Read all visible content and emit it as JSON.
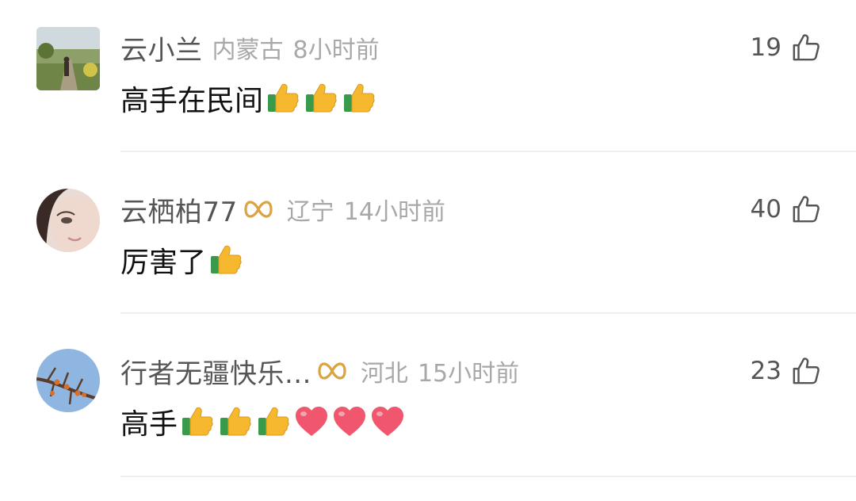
{
  "comments": [
    {
      "username": "云小兰",
      "vip": false,
      "location": "内蒙古",
      "time": "8小时前",
      "likes": "19",
      "text": "高手在民间",
      "emojis": [
        "thumbs-up",
        "thumbs-up",
        "thumbs-up"
      ]
    },
    {
      "username": "云栖柏77",
      "vip": true,
      "location": "辽宁",
      "time": "14小时前",
      "likes": "40",
      "text": "厉害了",
      "emojis": [
        "thumbs-up"
      ]
    },
    {
      "username": "行者无疆快乐...",
      "vip": true,
      "location": "河北",
      "time": "15小时前",
      "likes": "23",
      "text": "高手",
      "emojis": [
        "thumbs-up",
        "thumbs-up",
        "thumbs-up",
        "heart",
        "heart",
        "heart"
      ]
    }
  ],
  "colors": {
    "username": "#555555",
    "meta": "#a8a8a8",
    "vip_badge": "#d9a441",
    "heart": "#f0576e",
    "thumb": "#f5b82e",
    "cuff": "#3a9a4c"
  },
  "icons": {
    "like": "thumbs-up-outline-icon",
    "vip": "vip-infinity-icon",
    "emoji_thumb": "thumbs-up-emoji-icon",
    "emoji_heart": "heart-emoji-icon"
  }
}
